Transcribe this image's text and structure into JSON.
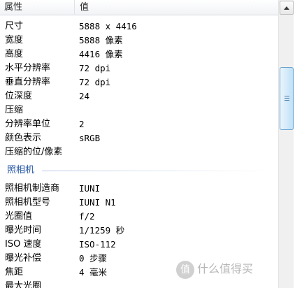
{
  "header": {
    "col_name": "属性",
    "col_value": "值"
  },
  "rows_top": [
    {
      "name": "尺寸",
      "value": "5888 x 4416"
    },
    {
      "name": "宽度",
      "value": "5888 像素"
    },
    {
      "name": "高度",
      "value": "4416 像素"
    },
    {
      "name": "水平分辨率",
      "value": "72 dpi"
    },
    {
      "name": "垂直分辨率",
      "value": "72 dpi"
    },
    {
      "name": "位深度",
      "value": "24"
    },
    {
      "name": "压缩",
      "value": ""
    },
    {
      "name": "分辨率单位",
      "value": "2"
    },
    {
      "name": "颜色表示",
      "value": "sRGB"
    },
    {
      "name": "压缩的位/像素",
      "value": ""
    }
  ],
  "group": {
    "title": "照相机"
  },
  "rows_camera": [
    {
      "name": "照相机制造商",
      "value": "IUNI"
    },
    {
      "name": "照相机型号",
      "value": "IUNI N1"
    },
    {
      "name": "光圈值",
      "value": "f/2"
    },
    {
      "name": "曝光时间",
      "value": "1/1259 秒"
    },
    {
      "name": "ISO 速度",
      "value": "ISO-112"
    },
    {
      "name": "曝光补偿",
      "value": "0 步骤"
    },
    {
      "name": "焦距",
      "value": "4 毫米"
    },
    {
      "name": "最大光圈",
      "value": ""
    }
  ],
  "watermark": {
    "badge": "值",
    "text": "什么值得买"
  }
}
